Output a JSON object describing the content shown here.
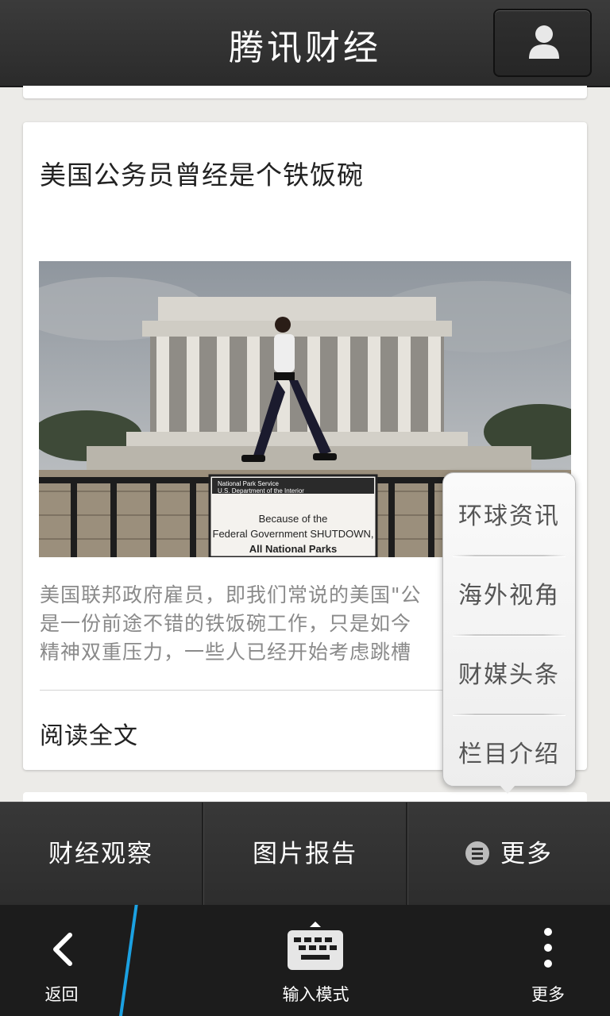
{
  "header": {
    "title": "腾讯财经",
    "profile_icon": "person-icon"
  },
  "article": {
    "headline": "美国公务员曾经是个铁饭碗",
    "photo_sign": {
      "line1": "National Park Service",
      "line2": "U.S. Department of the Interior",
      "line3": "Because of the",
      "line4": "Federal Government SHUTDOWN,",
      "line5": "All National Parks"
    },
    "summary_lines": [
      "美国联邦政府雇员，即我们常说的美国\"公",
      "是一份前途不错的铁饭碗工作，只是如今",
      "精神双重压力，一些人已经开始考虑跳槽"
    ],
    "read_more": "阅读全文"
  },
  "popup_menu": {
    "items": [
      "环球资讯",
      "海外视角",
      "财媒头条",
      "栏目介绍"
    ]
  },
  "tabs": {
    "tab1": "财经观察",
    "tab2": "图片报告",
    "tab3": "更多",
    "tab3_icon": "menu-list-icon"
  },
  "actionbar": {
    "back_label": "返回",
    "back_icon": "chevron-left-icon",
    "input_label": "输入模式",
    "input_icon": "keyboard-icon",
    "more_label": "更多",
    "more_icon": "vertical-dots-icon"
  },
  "colors": {
    "accent": "#1ba1e2",
    "header_bg": "#333333",
    "text_gray": "#8a8a8a"
  }
}
